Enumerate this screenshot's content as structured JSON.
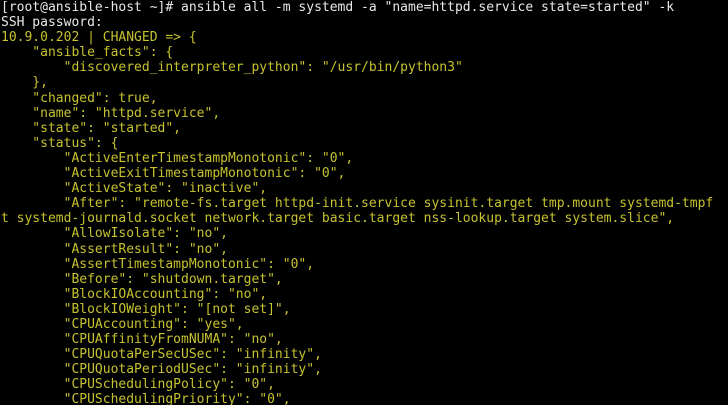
{
  "terminal": {
    "colors": {
      "background": "#000000",
      "text": "#e8e8e8",
      "changed_output": "#c6c230"
    },
    "lines": [
      {
        "text": "[root@ansible-host ~]# ansible all -m systemd -a \"name=httpd.service state=started\" -k",
        "style": "white"
      },
      {
        "text": "SSH password:",
        "style": "white"
      },
      {
        "text": "10.9.0.202 | CHANGED => {",
        "style": "yellow"
      },
      {
        "text": "    \"ansible_facts\": {",
        "style": "yellow"
      },
      {
        "text": "        \"discovered_interpreter_python\": \"/usr/bin/python3\"",
        "style": "yellow"
      },
      {
        "text": "    },",
        "style": "yellow"
      },
      {
        "text": "    \"changed\": true,",
        "style": "yellow"
      },
      {
        "text": "    \"name\": \"httpd.service\",",
        "style": "yellow"
      },
      {
        "text": "    \"state\": \"started\",",
        "style": "yellow"
      },
      {
        "text": "    \"status\": {",
        "style": "yellow"
      },
      {
        "text": "        \"ActiveEnterTimestampMonotonic\": \"0\",",
        "style": "yellow"
      },
      {
        "text": "        \"ActiveExitTimestampMonotonic\": \"0\",",
        "style": "yellow"
      },
      {
        "text": "        \"ActiveState\": \"inactive\",",
        "style": "yellow"
      },
      {
        "text": "        \"After\": \"remote-fs.target httpd-init.service sysinit.target tmp.mount systemd-tmpf",
        "style": "yellow"
      },
      {
        "text": "t systemd-journald.socket network.target basic.target nss-lookup.target system.slice\",",
        "style": "yellow"
      },
      {
        "text": "        \"AllowIsolate\": \"no\",",
        "style": "yellow"
      },
      {
        "text": "        \"AssertResult\": \"no\",",
        "style": "yellow"
      },
      {
        "text": "        \"AssertTimestampMonotonic\": \"0\",",
        "style": "yellow"
      },
      {
        "text": "        \"Before\": \"shutdown.target\",",
        "style": "yellow"
      },
      {
        "text": "        \"BlockIOAccounting\": \"no\",",
        "style": "yellow"
      },
      {
        "text": "        \"BlockIOWeight\": \"[not set]\",",
        "style": "yellow"
      },
      {
        "text": "        \"CPUAccounting\": \"yes\",",
        "style": "yellow"
      },
      {
        "text": "        \"CPUAffinityFromNUMA\": \"no\",",
        "style": "yellow"
      },
      {
        "text": "        \"CPUQuotaPerSecUSec\": \"infinity\",",
        "style": "yellow"
      },
      {
        "text": "        \"CPUQuotaPeriodUSec\": \"infinity\",",
        "style": "yellow"
      },
      {
        "text": "        \"CPUSchedulingPolicy\": \"0\",",
        "style": "yellow"
      },
      {
        "text": "        \"CPUSchedulingPriority\": \"0\",",
        "style": "yellow"
      }
    ]
  }
}
